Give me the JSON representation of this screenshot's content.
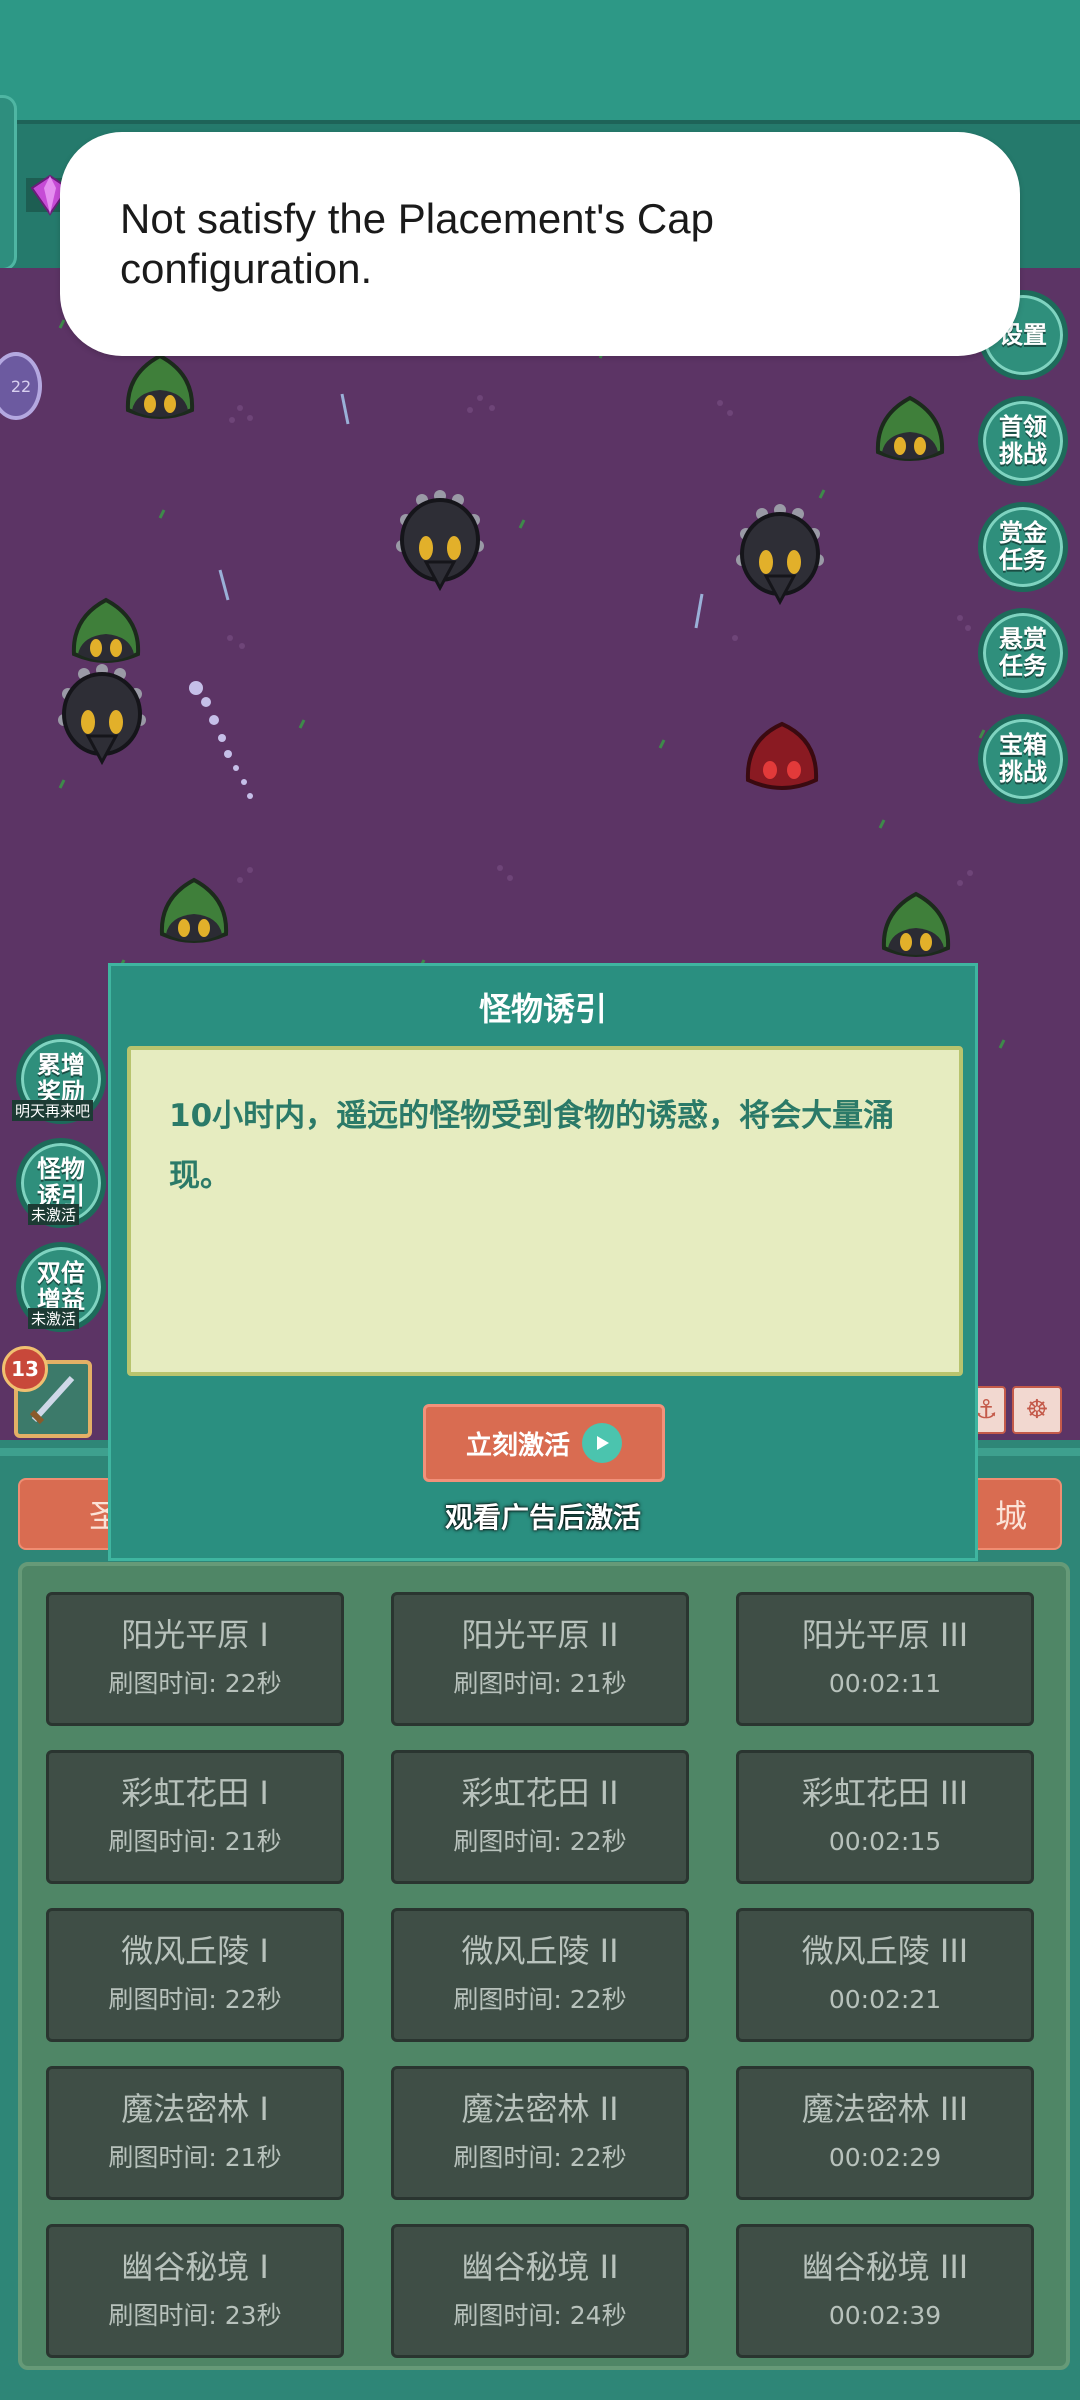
{
  "toast": {
    "message": "Not satisfy the Placement's Cap configuration."
  },
  "right_buttons": [
    {
      "label": "设置"
    },
    {
      "label": "首领挑战"
    },
    {
      "label": "赏金任务"
    },
    {
      "label": "悬赏任务"
    },
    {
      "label": "宝箱挑战"
    }
  ],
  "left_buttons": [
    {
      "label": "累增奖励",
      "sub": "明天再来吧"
    },
    {
      "label": "怪物诱引",
      "sub": "未激活"
    },
    {
      "label": "双倍增益",
      "sub": "未激活"
    }
  ],
  "hud": {
    "level": "22",
    "skill_level": "13"
  },
  "modal": {
    "title": "怪物诱引",
    "description": "10小时内，遥远的怪物受到食物的诱惑，将会大量涌现。",
    "activate_label": "立刻激活",
    "ad_note": "观看广告后激活"
  },
  "tabs": {
    "left": "圣",
    "right": "城"
  },
  "maps": [
    {
      "name": "阳光平原 I",
      "info": "刷图时间: 22秒"
    },
    {
      "name": "阳光平原 II",
      "info": "刷图时间: 21秒"
    },
    {
      "name": "阳光平原 III",
      "info": "00:02:11"
    },
    {
      "name": "彩虹花田 I",
      "info": "刷图时间: 21秒"
    },
    {
      "name": "彩虹花田 II",
      "info": "刷图时间: 22秒"
    },
    {
      "name": "彩虹花田 III",
      "info": "00:02:15"
    },
    {
      "name": "微风丘陵 I",
      "info": "刷图时间: 22秒"
    },
    {
      "name": "微风丘陵 II",
      "info": "刷图时间: 22秒"
    },
    {
      "name": "微风丘陵 III",
      "info": "00:02:21"
    },
    {
      "name": "魔法密林 I",
      "info": "刷图时间: 21秒"
    },
    {
      "name": "魔法密林 II",
      "info": "刷图时间: 22秒"
    },
    {
      "name": "魔法密林 III",
      "info": "00:02:29"
    },
    {
      "name": "幽谷秘境 I",
      "info": "刷图时间: 23秒"
    },
    {
      "name": "幽谷秘境 II",
      "info": "刷图时间: 24秒"
    },
    {
      "name": "幽谷秘境 III",
      "info": "00:02:39"
    }
  ],
  "colors": {
    "field": "#5c3465",
    "panel": "#2a8f80",
    "button": "#d96c51",
    "slime": "#3f7f3a",
    "beetle": "#2e2e36",
    "red_slime": "#8a1a22"
  }
}
